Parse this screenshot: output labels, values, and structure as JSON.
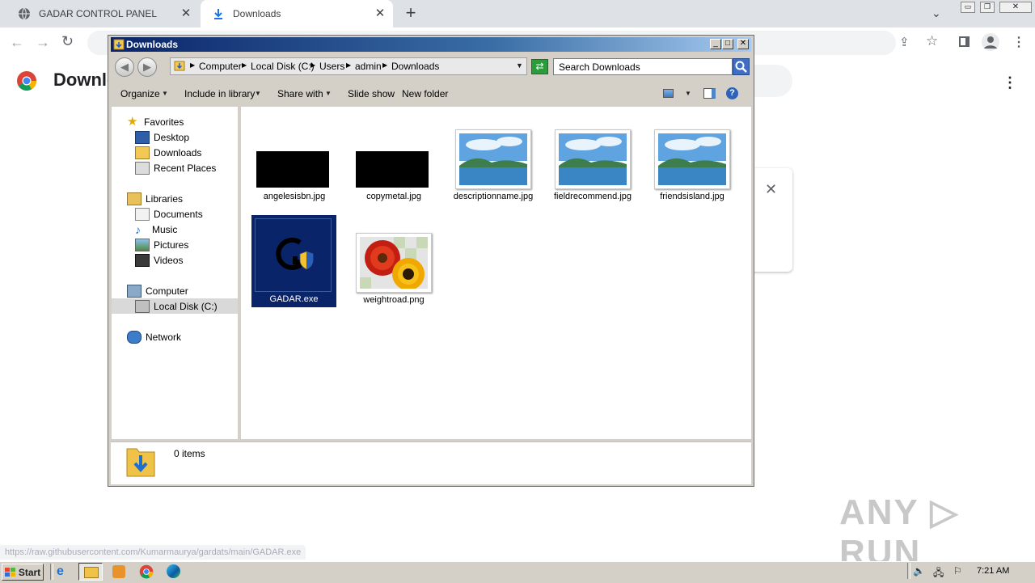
{
  "browser": {
    "tabs": [
      {
        "label": "GADAR CONTROL PANEL",
        "icon": "globe-icon"
      },
      {
        "label": "Downloads",
        "icon": "download-icon"
      }
    ],
    "page_title": "Downle",
    "status_url": "https://raw.githubusercontent.com/Kumarmaurya/gardats/main/GADAR.exe"
  },
  "explorer": {
    "title": "Downloads",
    "breadcrumb": [
      "Computer",
      "Local Disk (C:)",
      "Users",
      "admin",
      "Downloads"
    ],
    "search_placeholder": "Search Downloads",
    "commands": [
      "Organize",
      "Include in library",
      "Share with",
      "Slide show",
      "New folder"
    ],
    "nav": {
      "favorites_label": "Favorites",
      "favorites": [
        "Desktop",
        "Downloads",
        "Recent Places"
      ],
      "libraries_label": "Libraries",
      "libraries": [
        "Documents",
        "Music",
        "Pictures",
        "Videos"
      ],
      "computer_label": "Computer",
      "computer": [
        "Local Disk (C:)"
      ],
      "network_label": "Network"
    },
    "files": [
      {
        "name": "angelesisbn.jpg",
        "type": "black"
      },
      {
        "name": "copymetal.jpg",
        "type": "black"
      },
      {
        "name": "descriptionname.jpg",
        "type": "landscape"
      },
      {
        "name": "fieldrecommend.jpg",
        "type": "landscape"
      },
      {
        "name": "friendsisland.jpg",
        "type": "landscape"
      },
      {
        "name": "GADAR.exe",
        "type": "exe",
        "selected": true
      },
      {
        "name": "weightroad.png",
        "type": "flower"
      }
    ],
    "status": "0 items"
  },
  "taskbar": {
    "start_label": "Start",
    "clock": "7:21 AM"
  },
  "watermark": "ANY RUN"
}
